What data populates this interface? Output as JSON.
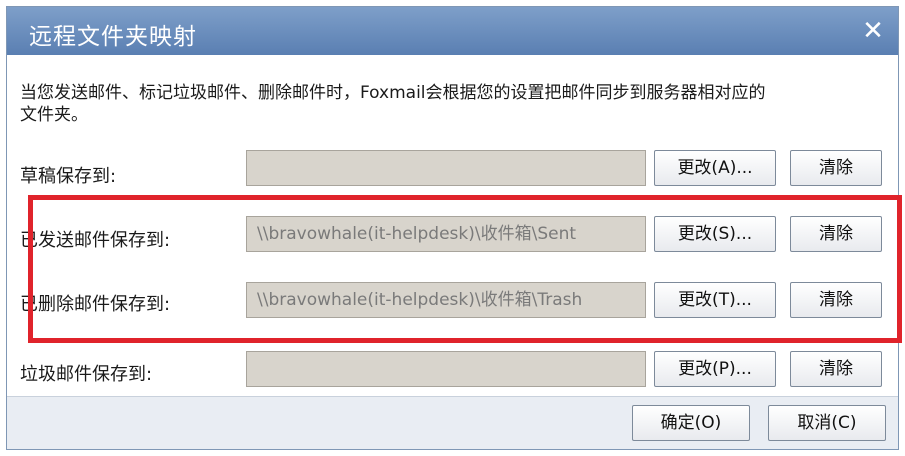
{
  "window": {
    "title": "远程文件夹映射",
    "close_glyph": "✕"
  },
  "description": "当您发送邮件、标记垃圾邮件、删除邮件时，Foxmail会根据您的设置把邮件同步到服务器相对应的文件夹。",
  "rows": [
    {
      "label": "草稿保存到:",
      "value": "",
      "change_label": "更改(A)...",
      "clear_label": "清除"
    },
    {
      "label": "已发送邮件保存到:",
      "value": "\\\\bravowhale(it-helpdesk)\\收件箱\\Sent",
      "change_label": "更改(S)...",
      "clear_label": "清除"
    },
    {
      "label": "已删除邮件保存到:",
      "value": "\\\\bravowhale(it-helpdesk)\\收件箱\\Trash",
      "change_label": "更改(T)...",
      "clear_label": "清除"
    },
    {
      "label": "垃圾邮件保存到:",
      "value": "",
      "change_label": "更改(P)...",
      "clear_label": "清除"
    }
  ],
  "footer": {
    "ok_label": "确定(O)",
    "cancel_label": "取消(C)"
  },
  "colors": {
    "titlebar": "#6b8fc0",
    "highlight_border": "#e0232b",
    "field_bg": "#d8d4cc"
  }
}
